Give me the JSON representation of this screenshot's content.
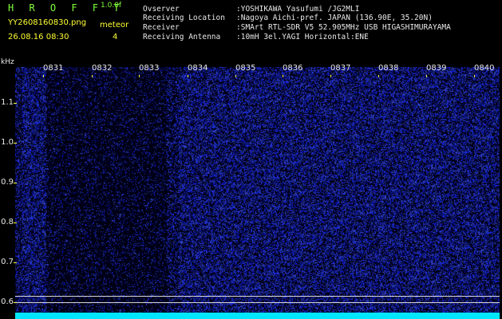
{
  "header": {
    "app_title": "H R O F F T",
    "version": "1.0.0f",
    "file_name": "YY2608160830.png",
    "meteor_label": "meteor",
    "date_time": "26.08.16 08:30",
    "meteor_count": "4"
  },
  "info": [
    {
      "key": "Ovserver",
      "value": ":YOSHIKAWA Yasufumi /JG2MLI"
    },
    {
      "key": "Receiving Location",
      "value": ":Nagoya Aichi-pref. JAPAN (136.90E, 35.20N)"
    },
    {
      "key": "Receiver",
      "value": ":SMArt RTL-SDR V5 52.905MHz USB HIGASHIMURAYAMA"
    },
    {
      "key": "Receiving Antenna",
      "value": ":10mH 3el.YAGI Horizontal:ENE"
    }
  ],
  "spectrogram": {
    "y_unit": "kHz",
    "y_labels": [
      "1.1",
      "1.0",
      "0.9",
      "0.8",
      "0.7",
      "0.6"
    ],
    "x_labels": [
      "0831",
      "0832",
      "0833",
      "0834",
      "0835",
      "0836",
      "0837",
      "0838",
      "0839",
      "0840"
    ],
    "colors": {
      "background": "#000000",
      "noise": "#1a33ff",
      "axis": "#ffff33",
      "signal": "#00e6ff"
    }
  }
}
